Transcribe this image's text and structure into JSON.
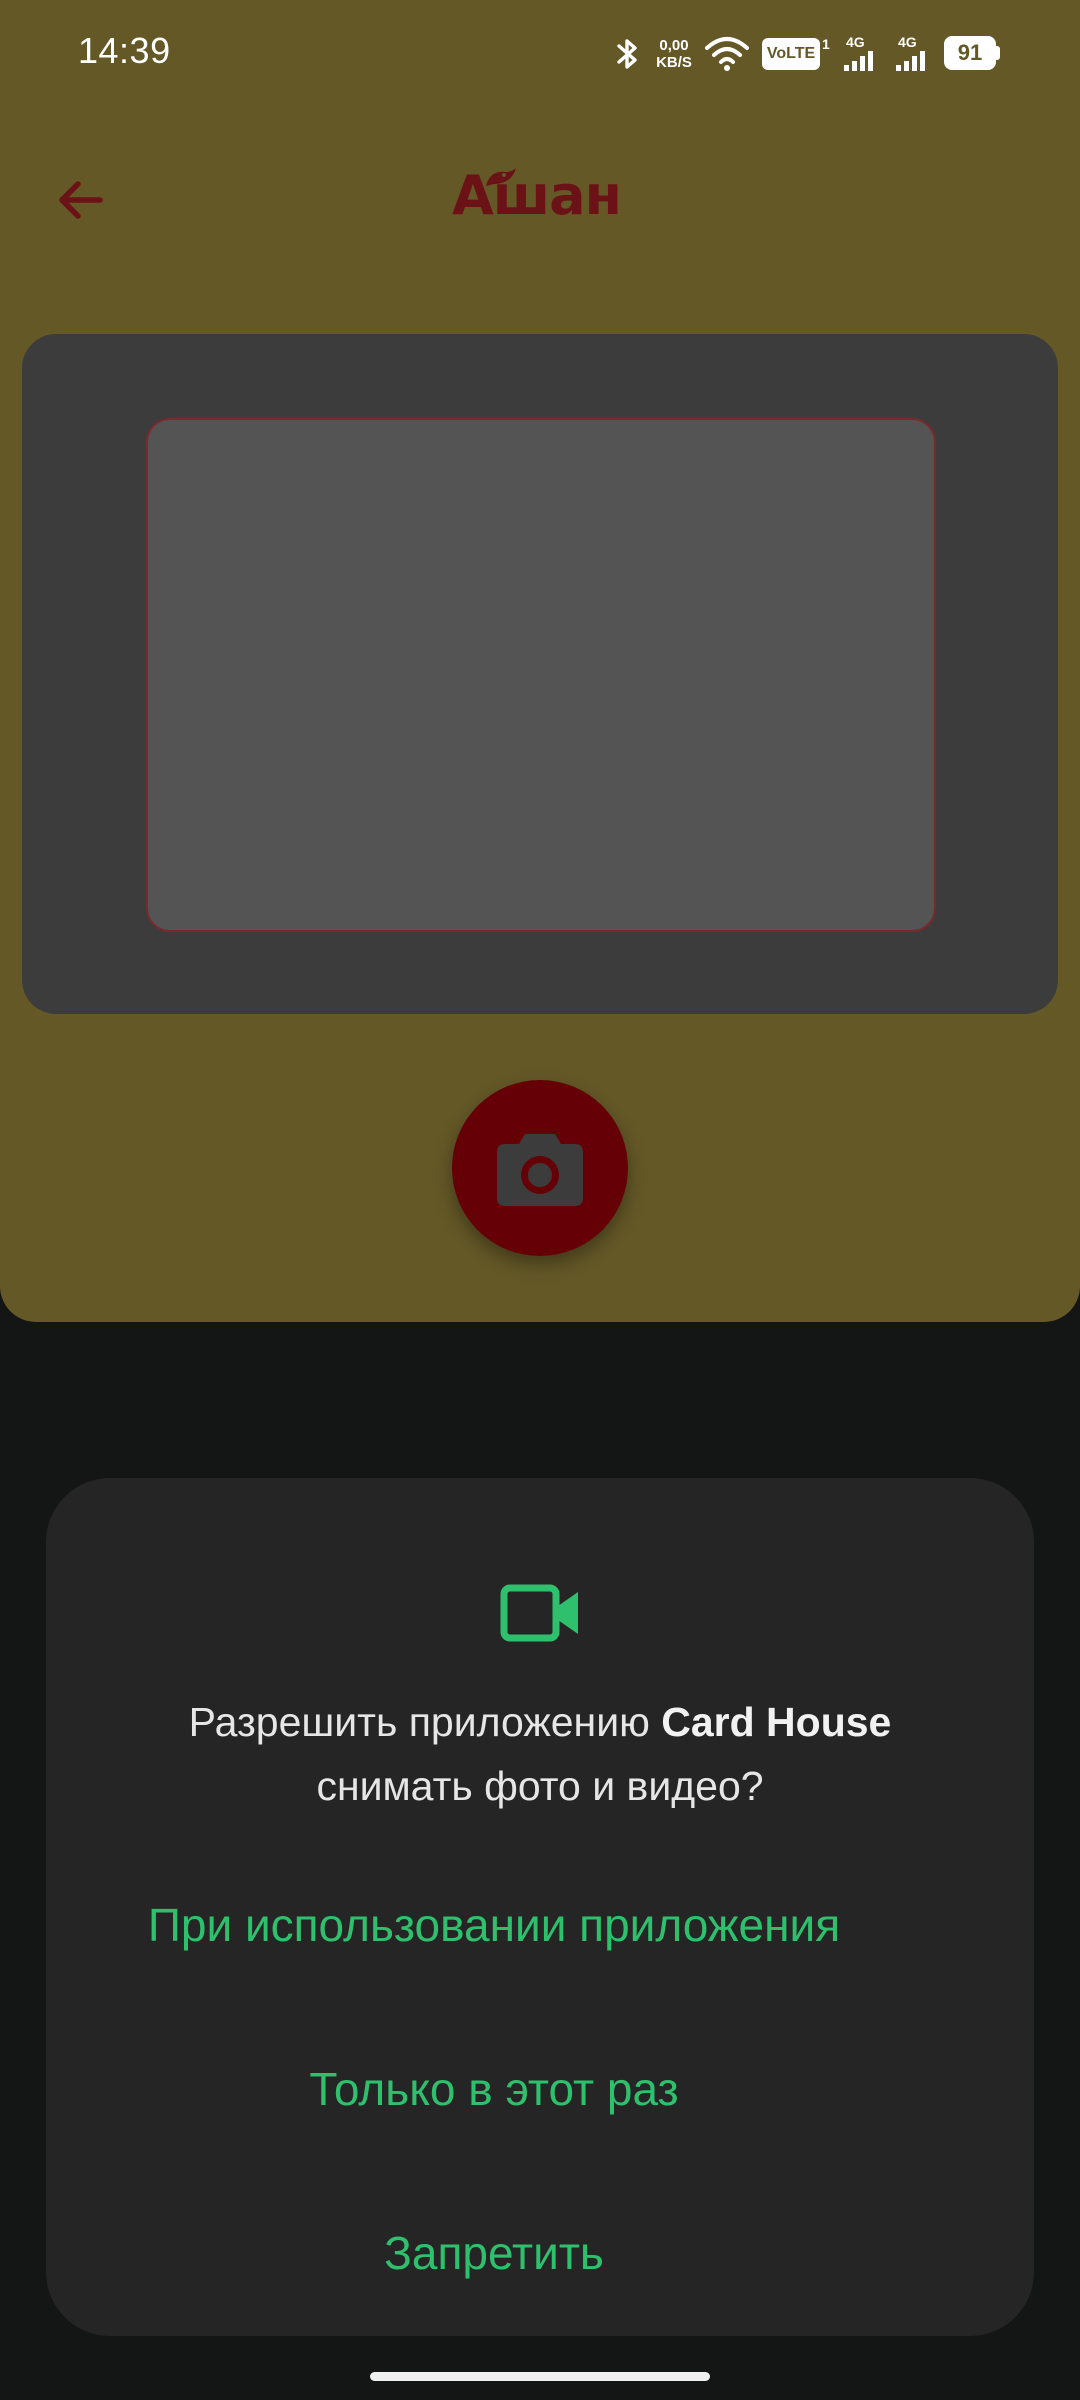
{
  "status_bar": {
    "time": "14:39",
    "net_speed_value": "0,00",
    "net_speed_unit": "KB/S",
    "volte": "VoLTE",
    "volte_sub": "1",
    "signal1_label": "4G",
    "signal2_label": "4G",
    "battery": "91"
  },
  "header": {
    "brand": "Ашан"
  },
  "dialog": {
    "message_prefix": "Разрешить приложению ",
    "app_name": "Card House",
    "message_suffix": "снимать фото и видео?",
    "btn_while_using": "При использовании приложения",
    "btn_only_once": "Только в этот раз",
    "btn_deny": "Запретить"
  },
  "colors": {
    "app_background": "#645827",
    "brand_red": "#660007",
    "accent_green": "#2fc06d",
    "dialog_background": "#252525"
  },
  "icons": {
    "back": "arrow-left-icon",
    "shutter": "camera-icon",
    "dialog": "videocam-icon"
  }
}
